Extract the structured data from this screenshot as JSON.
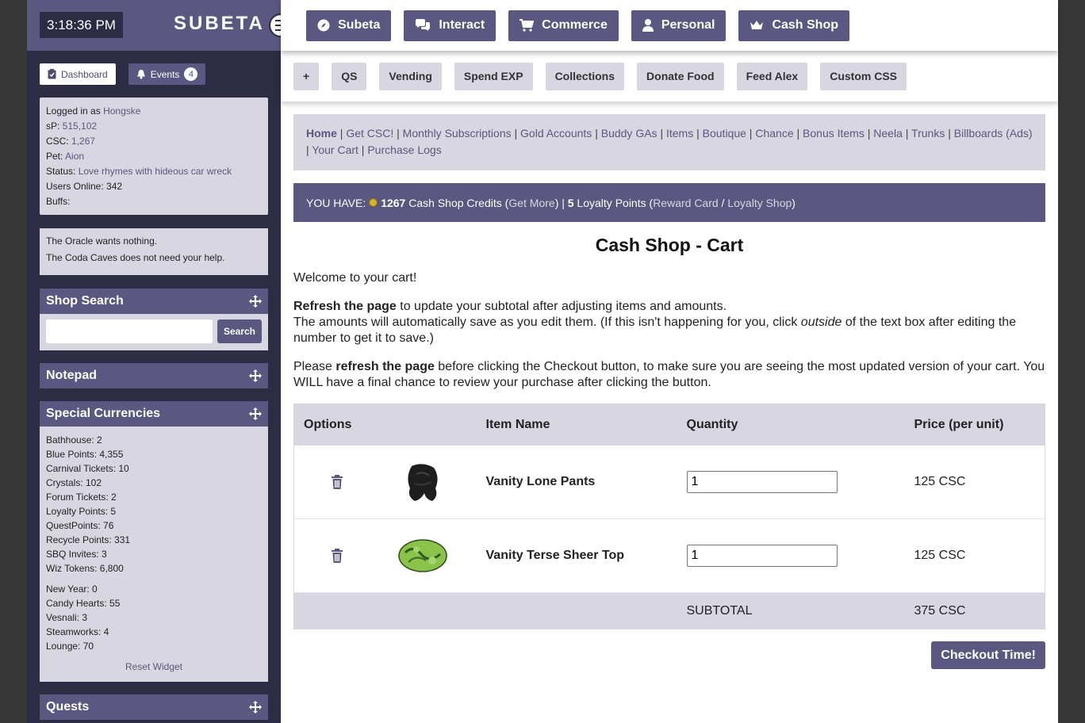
{
  "sidebar": {
    "clock": "3:18:36 PM",
    "logo": "SUBETA",
    "tabs": {
      "dashboard": "Dashboard",
      "events": "Events",
      "events_count": "4"
    },
    "user": {
      "logged_in_label": "Logged in as ",
      "username": "Hongske",
      "sp_label": "sP: ",
      "sp": "515,102",
      "csc_label": "CSC: ",
      "csc": "1,267",
      "pet_label": "Pet: ",
      "pet": "Aion",
      "status_label": "Status: ",
      "status": "Love rhymes with hideous car wreck",
      "online_label": "Users Online: ",
      "online": "342",
      "buffs_label": "Buffs:"
    },
    "oracle": [
      "The Oracle wants nothing.",
      "The Coda Caves does not need your help."
    ],
    "widgets": {
      "shop_search": "Shop Search",
      "search_button": "Search",
      "notepad": "Notepad",
      "currencies": "Special Currencies",
      "quests": "Quests"
    },
    "currencies_a": [
      "Bathhouse: 2",
      "Blue Points: 4,355",
      "Carnival Tickets: 10",
      "Crystals: 102",
      "Forum Tickets: 2",
      "Loyalty Points: 5",
      "QuestPoints: 76",
      "Recycle Points: 331",
      "SBQ Invites: 3",
      "Wiz Tokens: 6,800"
    ],
    "currencies_b": [
      "New Year: 0",
      "Candy Hearts: 55",
      "Vesnali: 3",
      "Steamworks: 4",
      "Lounge: 70"
    ],
    "reset_widget": "Reset Widget"
  },
  "topnav": [
    "Subeta",
    "Interact",
    "Commerce",
    "Personal",
    "Cash Shop"
  ],
  "subnav": [
    "+",
    "QS",
    "Vending",
    "Spend EXP",
    "Collections",
    "Donate Food",
    "Feed Alex",
    "Custom CSS"
  ],
  "breadcrumbs": [
    "Home",
    "Get CSC!",
    "Monthly Subscriptions",
    "Gold Accounts",
    "Buddy GAs",
    "Items",
    "Boutique",
    "Chance",
    "Bonus Items",
    "Neela",
    "Trunks",
    "Billboards (Ads)",
    "Your Cart",
    "Purchase Logs"
  ],
  "credits": {
    "you_have": "YOU HAVE:",
    "csc_amount": "1267",
    "csc_label": "Cash Shop Credits",
    "get_more": "Get More",
    "lp_amount": "5",
    "lp_label": "Loyalty Points",
    "reward_card": "Reward Card",
    "loyalty_shop": "Loyalty Shop"
  },
  "page": {
    "title": "Cash Shop - Cart",
    "welcome": "Welcome to your cart!",
    "refresh_bold": "Refresh the page",
    "refresh_rest": " to update your subtotal after adjusting items and amounts.",
    "autosave_a": "The amounts will automatically save as you edit them. (If this isn't happening for you, click ",
    "autosave_em": "outside",
    "autosave_b": " of the text box after editing the number to get it to save.)",
    "please_a": "Please ",
    "please_bold": "refresh the page",
    "please_b": " before clicking the Checkout button, to make sure you are seeing the most updated version of your cart. You WILL have a final chance to review your purchase after clicking the button."
  },
  "cart": {
    "headers": {
      "options": "Options",
      "item": "Item Name",
      "quantity": "Quantity",
      "price": "Price (per unit)"
    },
    "items": [
      {
        "name": "Vanity Lone Pants",
        "quantity": "1",
        "price": "125 CSC"
      },
      {
        "name": "Vanity Terse Sheer Top",
        "quantity": "1",
        "price": "125 CSC"
      }
    ],
    "subtotal_label": "SUBTOTAL",
    "subtotal": "375 CSC",
    "checkout": "Checkout Time!"
  }
}
